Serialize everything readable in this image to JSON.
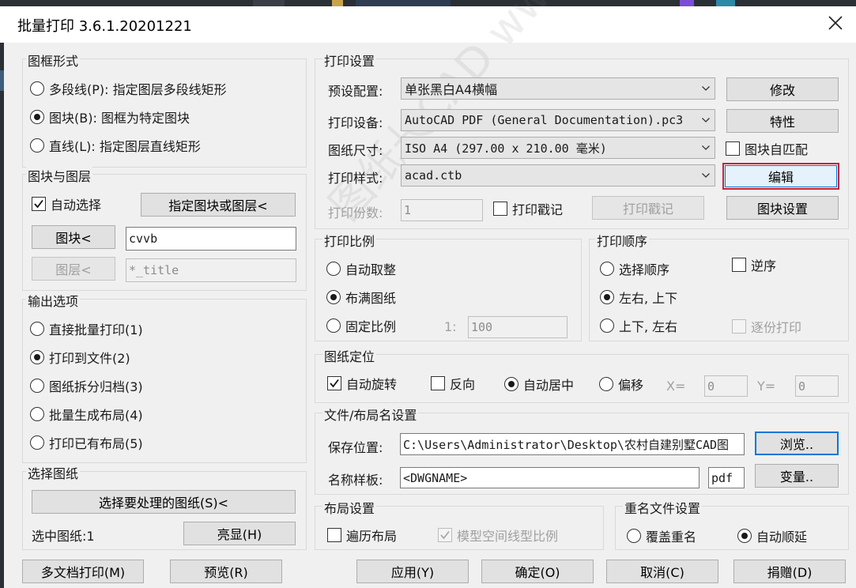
{
  "window": {
    "title": "批量打印 3.6.1.20201221"
  },
  "frame_style": {
    "label": "图框形式",
    "options": [
      {
        "label": "多段线(P): 指定图层多段线矩形",
        "checked": false
      },
      {
        "label": "图块(B): 图框为特定图块",
        "checked": true
      },
      {
        "label": "直线(L): 指定图层直线矩形",
        "checked": false
      }
    ]
  },
  "block_layer": {
    "label": "图块与图层",
    "auto_select": "自动选择",
    "assign_button": "指定图块或图层<",
    "block_button": "图块<",
    "block_value": "cvvb",
    "layer_button": "图层<",
    "layer_value": "*_title"
  },
  "output": {
    "label": "输出选项",
    "options": [
      {
        "label": "直接批量打印(1)",
        "checked": false
      },
      {
        "label": "打印到文件(2)",
        "checked": true
      },
      {
        "label": "图纸拆分归档(3)",
        "checked": false
      },
      {
        "label": "批量生成布局(4)",
        "checked": false
      },
      {
        "label": "打印已有布局(5)",
        "checked": false
      }
    ]
  },
  "select_sheets": {
    "label": "选择图纸",
    "select_button": "选择要处理的图纸(S)<",
    "selected_text": "选中图纸:1",
    "highlight_button": "亮显(H)"
  },
  "print_settings": {
    "label": "打印设置",
    "preset_label": "预设配置:",
    "preset_value": "单张黑白A4横幅",
    "modify_button": "修改",
    "device_label": "打印设备:",
    "device_value": "AutoCAD PDF (General Documentation).pc3",
    "properties_button": "特性",
    "paper_label": "图纸尺寸:",
    "paper_value": "ISO A4 (297.00 x 210.00 毫米)",
    "auto_match": "图块自匹配",
    "style_label": "打印样式:",
    "style_value": "acad.ctb",
    "edit_button": "编辑",
    "copies_label": "打印份数:",
    "copies_value": "1",
    "stamp_check": "打印戳记",
    "stamp_button": "打印戳记",
    "block_settings_button": "图块设置"
  },
  "scale": {
    "label": "打印比例",
    "options": [
      {
        "label": "自动取整",
        "checked": false
      },
      {
        "label": "布满图纸",
        "checked": true
      },
      {
        "label": "固定比例",
        "checked": false
      }
    ],
    "ratio_prefix": "1:",
    "ratio_value": "100"
  },
  "order": {
    "label": "打印顺序",
    "options": [
      {
        "label": "选择顺序",
        "checked": false
      },
      {
        "label": "左右, 上下",
        "checked": true
      },
      {
        "label": "上下, 左右",
        "checked": false
      }
    ],
    "reverse": "逆序",
    "collate": "逐份打印"
  },
  "positioning": {
    "label": "图纸定位",
    "auto_rotate": "自动旋转",
    "reverse": "反向",
    "center": "自动居中",
    "offset": "偏移",
    "x_label": "X=",
    "x_value": "0",
    "y_label": "Y=",
    "y_value": "0"
  },
  "file_naming": {
    "label": "文件/布局名设置",
    "save_label": "保存位置:",
    "save_value": "C:\\Users\\Administrator\\Desktop\\农村自建别墅CAD图",
    "browse_button": "浏览..",
    "name_label": "名称样板:",
    "name_value": "<DWGNAME>",
    "ext_value": "pdf",
    "variables_button": "变量.."
  },
  "layout": {
    "label": "布局设置",
    "traverse": "遍历布局",
    "model_linetype": "模型空间线型比例"
  },
  "rename": {
    "label": "重名文件设置",
    "overwrite": "覆盖重名",
    "auto_increment": "自动顺延"
  },
  "bottom_buttons": {
    "multi_doc": "多文档打印(M)",
    "preview": "预览(R)",
    "apply": "应用(Y)",
    "ok": "确定(O)",
    "cancel": "取消(C)",
    "donate": "捐赠(D)"
  },
  "watermark": "图纸长CAD  www.zzzcad.com"
}
